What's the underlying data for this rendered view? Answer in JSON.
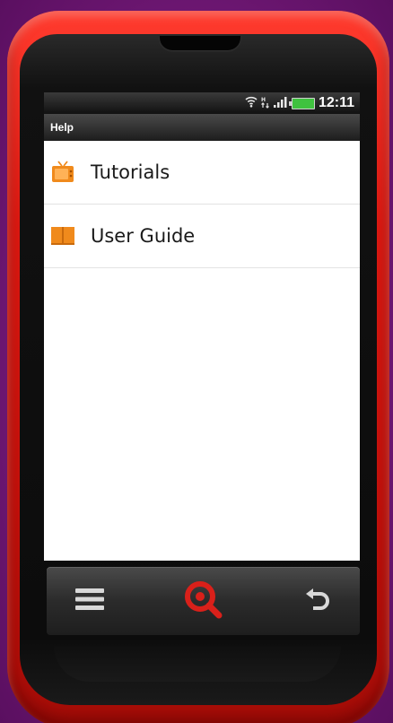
{
  "status_bar": {
    "wifi_icon": "wifi-icon",
    "data_icon": "mobile-data-icon",
    "signal_icon": "signal-icon",
    "battery_icon": "battery-icon",
    "time": "12:11"
  },
  "header": {
    "title": "Help"
  },
  "list": {
    "items": [
      {
        "label": "Tutorials",
        "icon": "tv-icon",
        "icon_color": "#f08a1c"
      },
      {
        "label": "User Guide",
        "icon": "book-icon",
        "icon_color": "#f08a1c"
      }
    ]
  },
  "nav_bar": {
    "menu_icon": "menu-icon",
    "search_icon": "search-icon",
    "back_icon": "back-icon",
    "search_color": "#d9201a"
  },
  "device": {
    "shell_color": "#e01a12",
    "background_color": "#7a1c80"
  }
}
